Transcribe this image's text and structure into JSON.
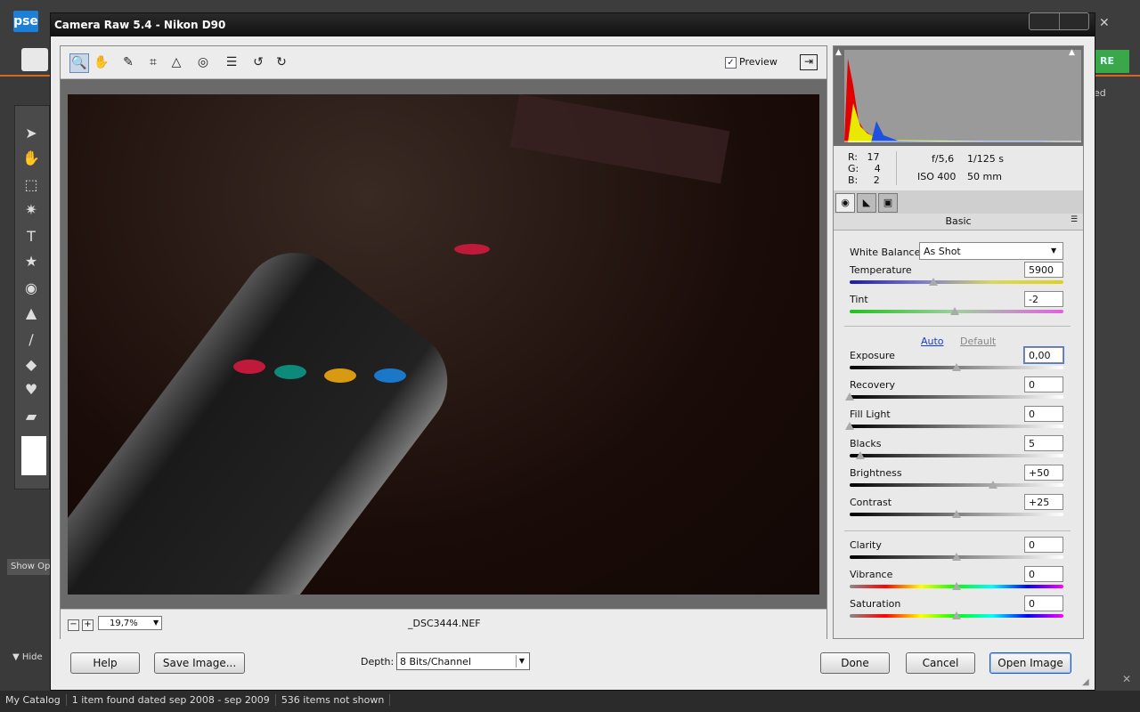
{
  "app": {
    "logo": "pse",
    "green_button": "RE",
    "right_label": "ed",
    "show_options": "Show Op",
    "hide": "Hide"
  },
  "status_bar": {
    "catalog": "My Catalog",
    "found": "1 item found dated sep 2008 - sep 2009",
    "not_shown": "536 items not shown"
  },
  "dialog": {
    "title": "Camera Raw 5.4  -  Nikon D90",
    "preview_label": "Preview",
    "preview_checked": true,
    "filename": "_DSC3444.NEF",
    "zoom": "19,7%",
    "rgb": {
      "r_label": "R:",
      "r": "17",
      "g_label": "G:",
      "g": "4",
      "b_label": "B:",
      "b": "2"
    },
    "camera": {
      "aperture": "f/5,6",
      "shutter": "1/125 s",
      "iso": "ISO 400",
      "focal": "50 mm"
    },
    "panel_title": "Basic",
    "white_balance": {
      "label": "White Balance:",
      "value": "As Shot"
    },
    "auto_link": "Auto",
    "default_link": "Default",
    "sliders": [
      {
        "label": "Temperature",
        "value": "5900",
        "level": 0.39
      },
      {
        "label": "Tint",
        "value": "-2",
        "level": 0.49
      },
      {
        "label": "Exposure",
        "value": "0,00",
        "level": 0.5
      },
      {
        "label": "Recovery",
        "value": "0",
        "level": 0.0
      },
      {
        "label": "Fill Light",
        "value": "0",
        "level": 0.0
      },
      {
        "label": "Blacks",
        "value": "5",
        "level": 0.05
      },
      {
        "label": "Brightness",
        "value": "+50",
        "level": 0.67
      },
      {
        "label": "Contrast",
        "value": "+25",
        "level": 0.5
      },
      {
        "label": "Clarity",
        "value": "0",
        "level": 0.5
      },
      {
        "label": "Vibrance",
        "value": "0",
        "level": 0.5
      },
      {
        "label": "Saturation",
        "value": "0",
        "level": 0.5
      }
    ],
    "buttons": {
      "help": "Help",
      "save": "Save Image...",
      "done": "Done",
      "cancel": "Cancel",
      "open": "Open Image"
    },
    "depth": {
      "label": "Depth:",
      "value": "8 Bits/Channel"
    },
    "colors": {
      "accent": "#1a5ad0",
      "link": "#1a3fbf"
    }
  }
}
